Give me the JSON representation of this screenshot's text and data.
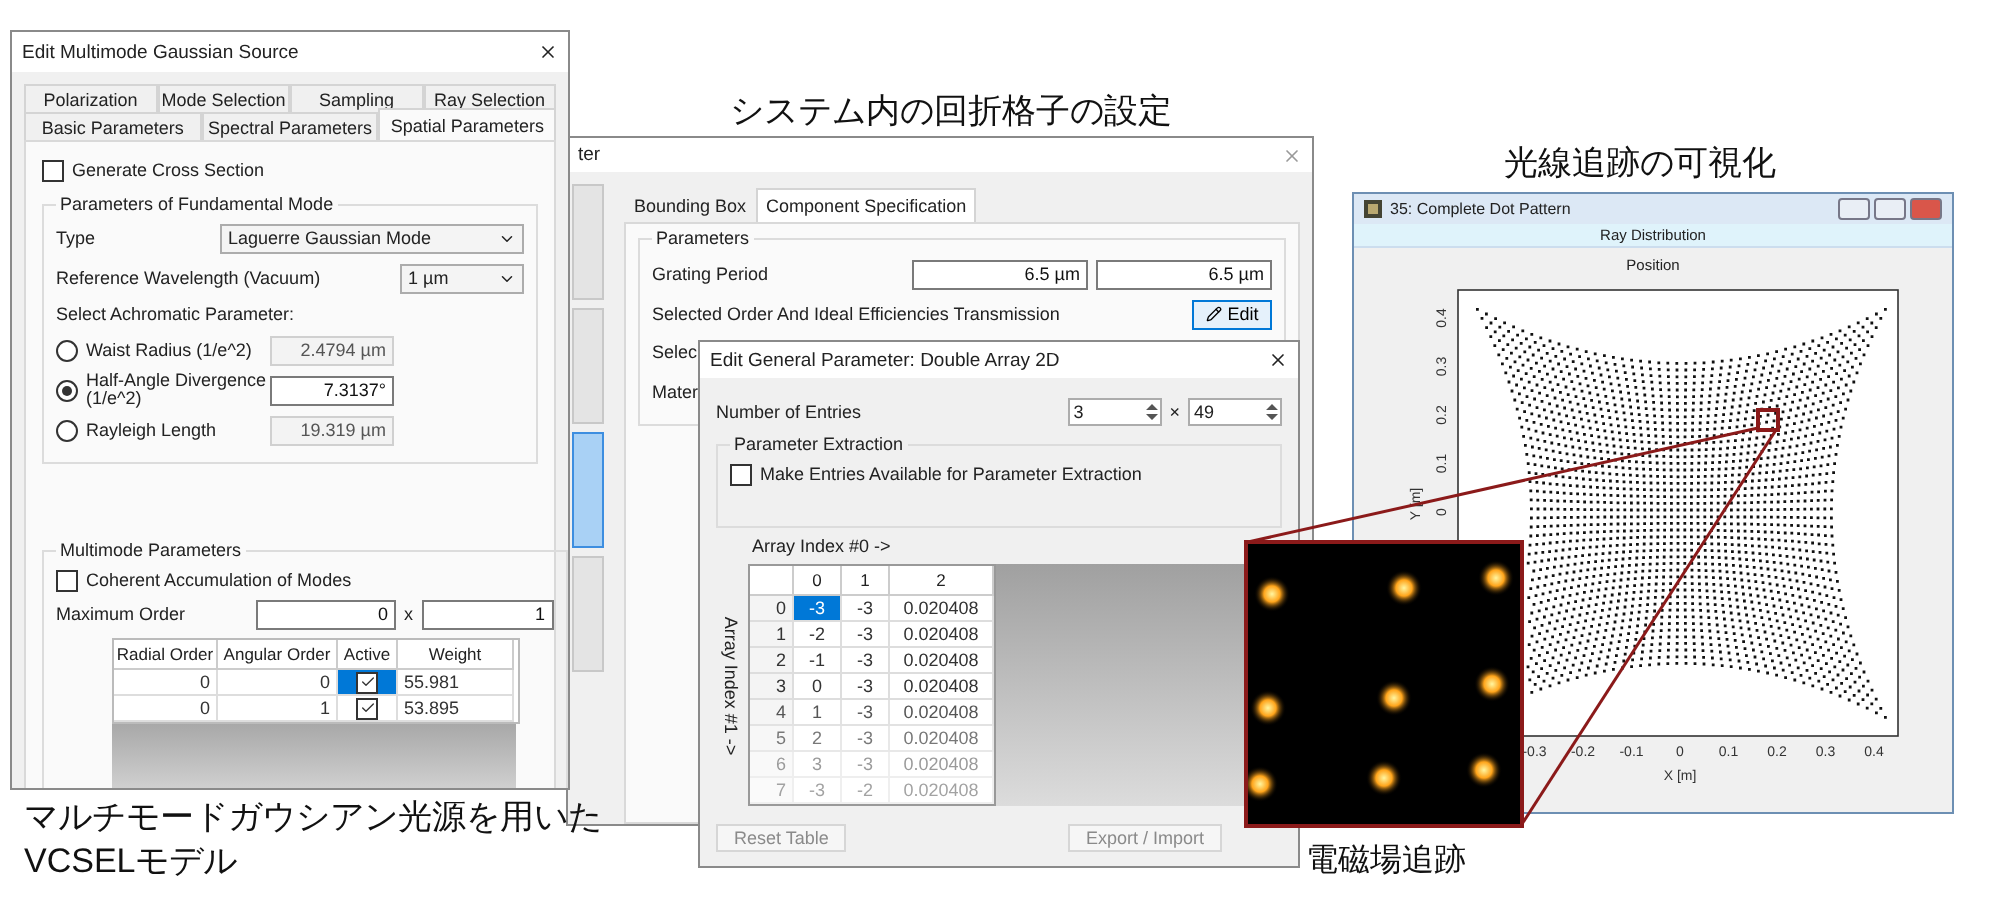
{
  "source_dialog": {
    "title": "Edit Multimode Gaussian Source",
    "tab_rows": [
      [
        {
          "label": "Polarization",
          "selected": false
        },
        {
          "label": "Mode Selection",
          "selected": false
        },
        {
          "label": "Sampling",
          "selected": false
        },
        {
          "label": "Ray Selection",
          "selected": false
        }
      ],
      [
        {
          "label": "Basic Parameters",
          "selected": false
        },
        {
          "label": "Spectral Parameters",
          "selected": false
        },
        {
          "label": "Spatial Parameters",
          "selected": true
        }
      ]
    ],
    "cross_section": {
      "label": "Generate Cross Section",
      "checked": false
    },
    "fundamental": {
      "legend": "Parameters of Fundamental Mode",
      "type": {
        "label": "Type",
        "value": "Laguerre Gaussian Mode"
      },
      "wavelength": {
        "label": "Reference Wavelength (Vacuum)",
        "value": "1 µm"
      },
      "achromatic_label": "Select Achromatic Parameter:",
      "options": [
        {
          "label": "Waist Radius (1/e^2)",
          "value": "2.4794 µm",
          "selected": false
        },
        {
          "label": "Half-Angle Divergence",
          "sublabel": "(1/e^2)",
          "value": "7.3137°",
          "selected": true
        },
        {
          "label": "Rayleigh Length",
          "value": "19.319 µm",
          "selected": false
        }
      ]
    },
    "multimode": {
      "legend": "Multimode Parameters",
      "coherent": {
        "label": "Coherent Accumulation of Modes",
        "checked": false
      },
      "max_order": {
        "label": "Maximum Order",
        "values": [
          "0",
          "1"
        ],
        "separator": "x"
      },
      "table": {
        "columns": [
          "Radial Order",
          "Angular Order",
          "Active",
          "Weight"
        ],
        "rows": [
          {
            "radial": "0",
            "angular": "0",
            "active": true,
            "weight": "55.981",
            "selected": true
          },
          {
            "radial": "0",
            "angular": "1",
            "active": true,
            "weight": "53.895",
            "selected": false
          }
        ]
      }
    },
    "caption": [
      "マルチモードガウシアン光源を用いた",
      "VCSELモデル"
    ]
  },
  "grating_heading": "システム内の回折格子の設定",
  "grating_window": {
    "title": "ter",
    "sidebar": [
      {
        "selected": false
      },
      {
        "selected": false
      },
      {
        "selected": true
      },
      {
        "selected": false
      }
    ],
    "tabs": [
      {
        "label": "Bounding Box",
        "selected": false
      },
      {
        "label": "Component Specification",
        "selected": true
      }
    ],
    "legend": "Parameters",
    "period": {
      "label": "Grating Period",
      "values": [
        "6.5 µm",
        "6.5 µm"
      ]
    },
    "order": {
      "label": "Selected Order And Ideal Efficiencies Transmission",
      "button": "Edit"
    },
    "cut_labels": [
      "Selec",
      "Mater"
    ]
  },
  "array_dialog": {
    "title": "Edit General Parameter: Double Array 2D",
    "entries": {
      "label": "Number of Entries",
      "values": [
        "3",
        "49"
      ],
      "separator": "×"
    },
    "extraction": {
      "legend": "Parameter Extraction",
      "checkbox": {
        "label": "Make Entries Available for Parameter Extraction",
        "checked": false
      }
    },
    "col_axis": "Array Index #0 ->",
    "row_axis": "Array Index #1 ->",
    "columns": [
      "0",
      "1",
      "2"
    ],
    "rows": [
      {
        "index": "0",
        "cells": [
          "-3",
          "-3",
          "0.020408"
        ],
        "selected": true
      },
      {
        "index": "1",
        "cells": [
          "-2",
          "-3",
          "0.020408"
        ],
        "selected": false
      },
      {
        "index": "2",
        "cells": [
          "-1",
          "-3",
          "0.020408"
        ],
        "selected": false
      },
      {
        "index": "3",
        "cells": [
          "0",
          "-3",
          "0.020408"
        ],
        "selected": false
      },
      {
        "index": "4",
        "cells": [
          "1",
          "-3",
          "0.020408"
        ],
        "selected": false
      },
      {
        "index": "5",
        "cells": [
          "2",
          "-3",
          "0.020408"
        ],
        "selected": false
      },
      {
        "index": "6",
        "cells": [
          "3",
          "-3",
          "0.020408"
        ],
        "selected": false
      },
      {
        "index": "7",
        "cells": [
          "-3",
          "-2",
          "0.020408"
        ],
        "selected": false
      }
    ],
    "buttons": [
      "Reset Table",
      "Export / Import"
    ]
  },
  "ray_heading": "光線追跡の可視化",
  "ray_window": {
    "title": "35: Complete Dot Pattern",
    "subtitle": "Ray Distribution",
    "plot_title": "Position",
    "xlabel": "X [m]",
    "ylabel": "Y [m]",
    "xticks": [
      "-0.3",
      "-0.2",
      "-0.1",
      "0",
      "0.1",
      "0.2",
      "0.3",
      "0.4"
    ],
    "yticks": [
      "0",
      "0.1",
      "0.2",
      "0.3",
      "0.4"
    ]
  },
  "field_inset": {
    "caption": "電磁場追跡"
  }
}
